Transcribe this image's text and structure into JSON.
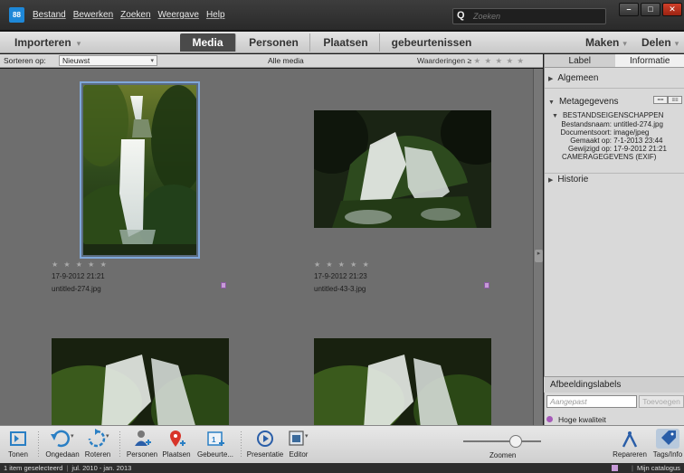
{
  "menu": [
    "Bestand",
    "Bewerken",
    "Zoeken",
    "Weergave",
    "Help"
  ],
  "app_logo": "88",
  "search": {
    "placeholder": "Zoeken",
    "icon": "Q"
  },
  "window_buttons": {
    "minimize": "–",
    "maximize": "□",
    "close": "✕"
  },
  "tabbar": {
    "import_label": "Importeren",
    "tabs": [
      "Media",
      "Personen",
      "Plaatsen",
      "gebeurtenissen"
    ],
    "active_tab": "Media",
    "maken": "Maken",
    "delen": "Delen"
  },
  "sortbar": {
    "label": "Sorteren op:",
    "selected": "Nieuwst",
    "center_label": "Alle media",
    "ratings_label": "Waarderingen",
    "ratings_op": "≥",
    "stars": "★ ★ ★ ★ ★"
  },
  "thumbnails": [
    {
      "stars": "★ ★ ★ ★ ★",
      "date": "17-9-2012 21:21",
      "filename": "untitled-274.jpg"
    },
    {
      "stars": "★ ★ ★ ★ ★",
      "date": "17-9-2012 21:23",
      "filename": "untitled-43-3.jpg"
    }
  ],
  "right_panel": {
    "tabs": [
      "Label",
      "Informatie"
    ],
    "active_tab": "Informatie",
    "sections": {
      "algemeen": "Algemeen",
      "metagegevens": "Metagegevens",
      "historie": "Historie"
    },
    "file_props_header": "BESTANDSEIGENSCHAPPEN",
    "properties": [
      {
        "key": "Bestandsnaam:",
        "value": "untitled-274.jpg"
      },
      {
        "key": "Documentsoort:",
        "value": "image/jpeg"
      },
      {
        "key": "Gemaakt op:",
        "value": "7-1-2013 23:44"
      },
      {
        "key": "Gewijzigd op:",
        "value": "17-9-2012 21:21"
      }
    ],
    "camera_header": "CAMERAGEGEVENS (EXIF)",
    "image_labels": {
      "header": "Afbeeldingslabels",
      "custom_placeholder": "Aangepast",
      "add_button": "Toevoegen",
      "tag": "Hoge kwaliteit"
    }
  },
  "toolbar": {
    "tools": [
      "Tonen",
      "Ongedaan",
      "Roteren",
      "Personen",
      "Plaatsen",
      "Gebeurte...",
      "Presentatie",
      "Editor"
    ],
    "zoom_label": "Zoomen",
    "right_tools": [
      "Repareren",
      "Tags/Info"
    ]
  },
  "status": {
    "selected": "1 item geselecteerd",
    "range": "jul. 2010 - jan. 2013",
    "catalog": "Mijn catalogus 1"
  }
}
